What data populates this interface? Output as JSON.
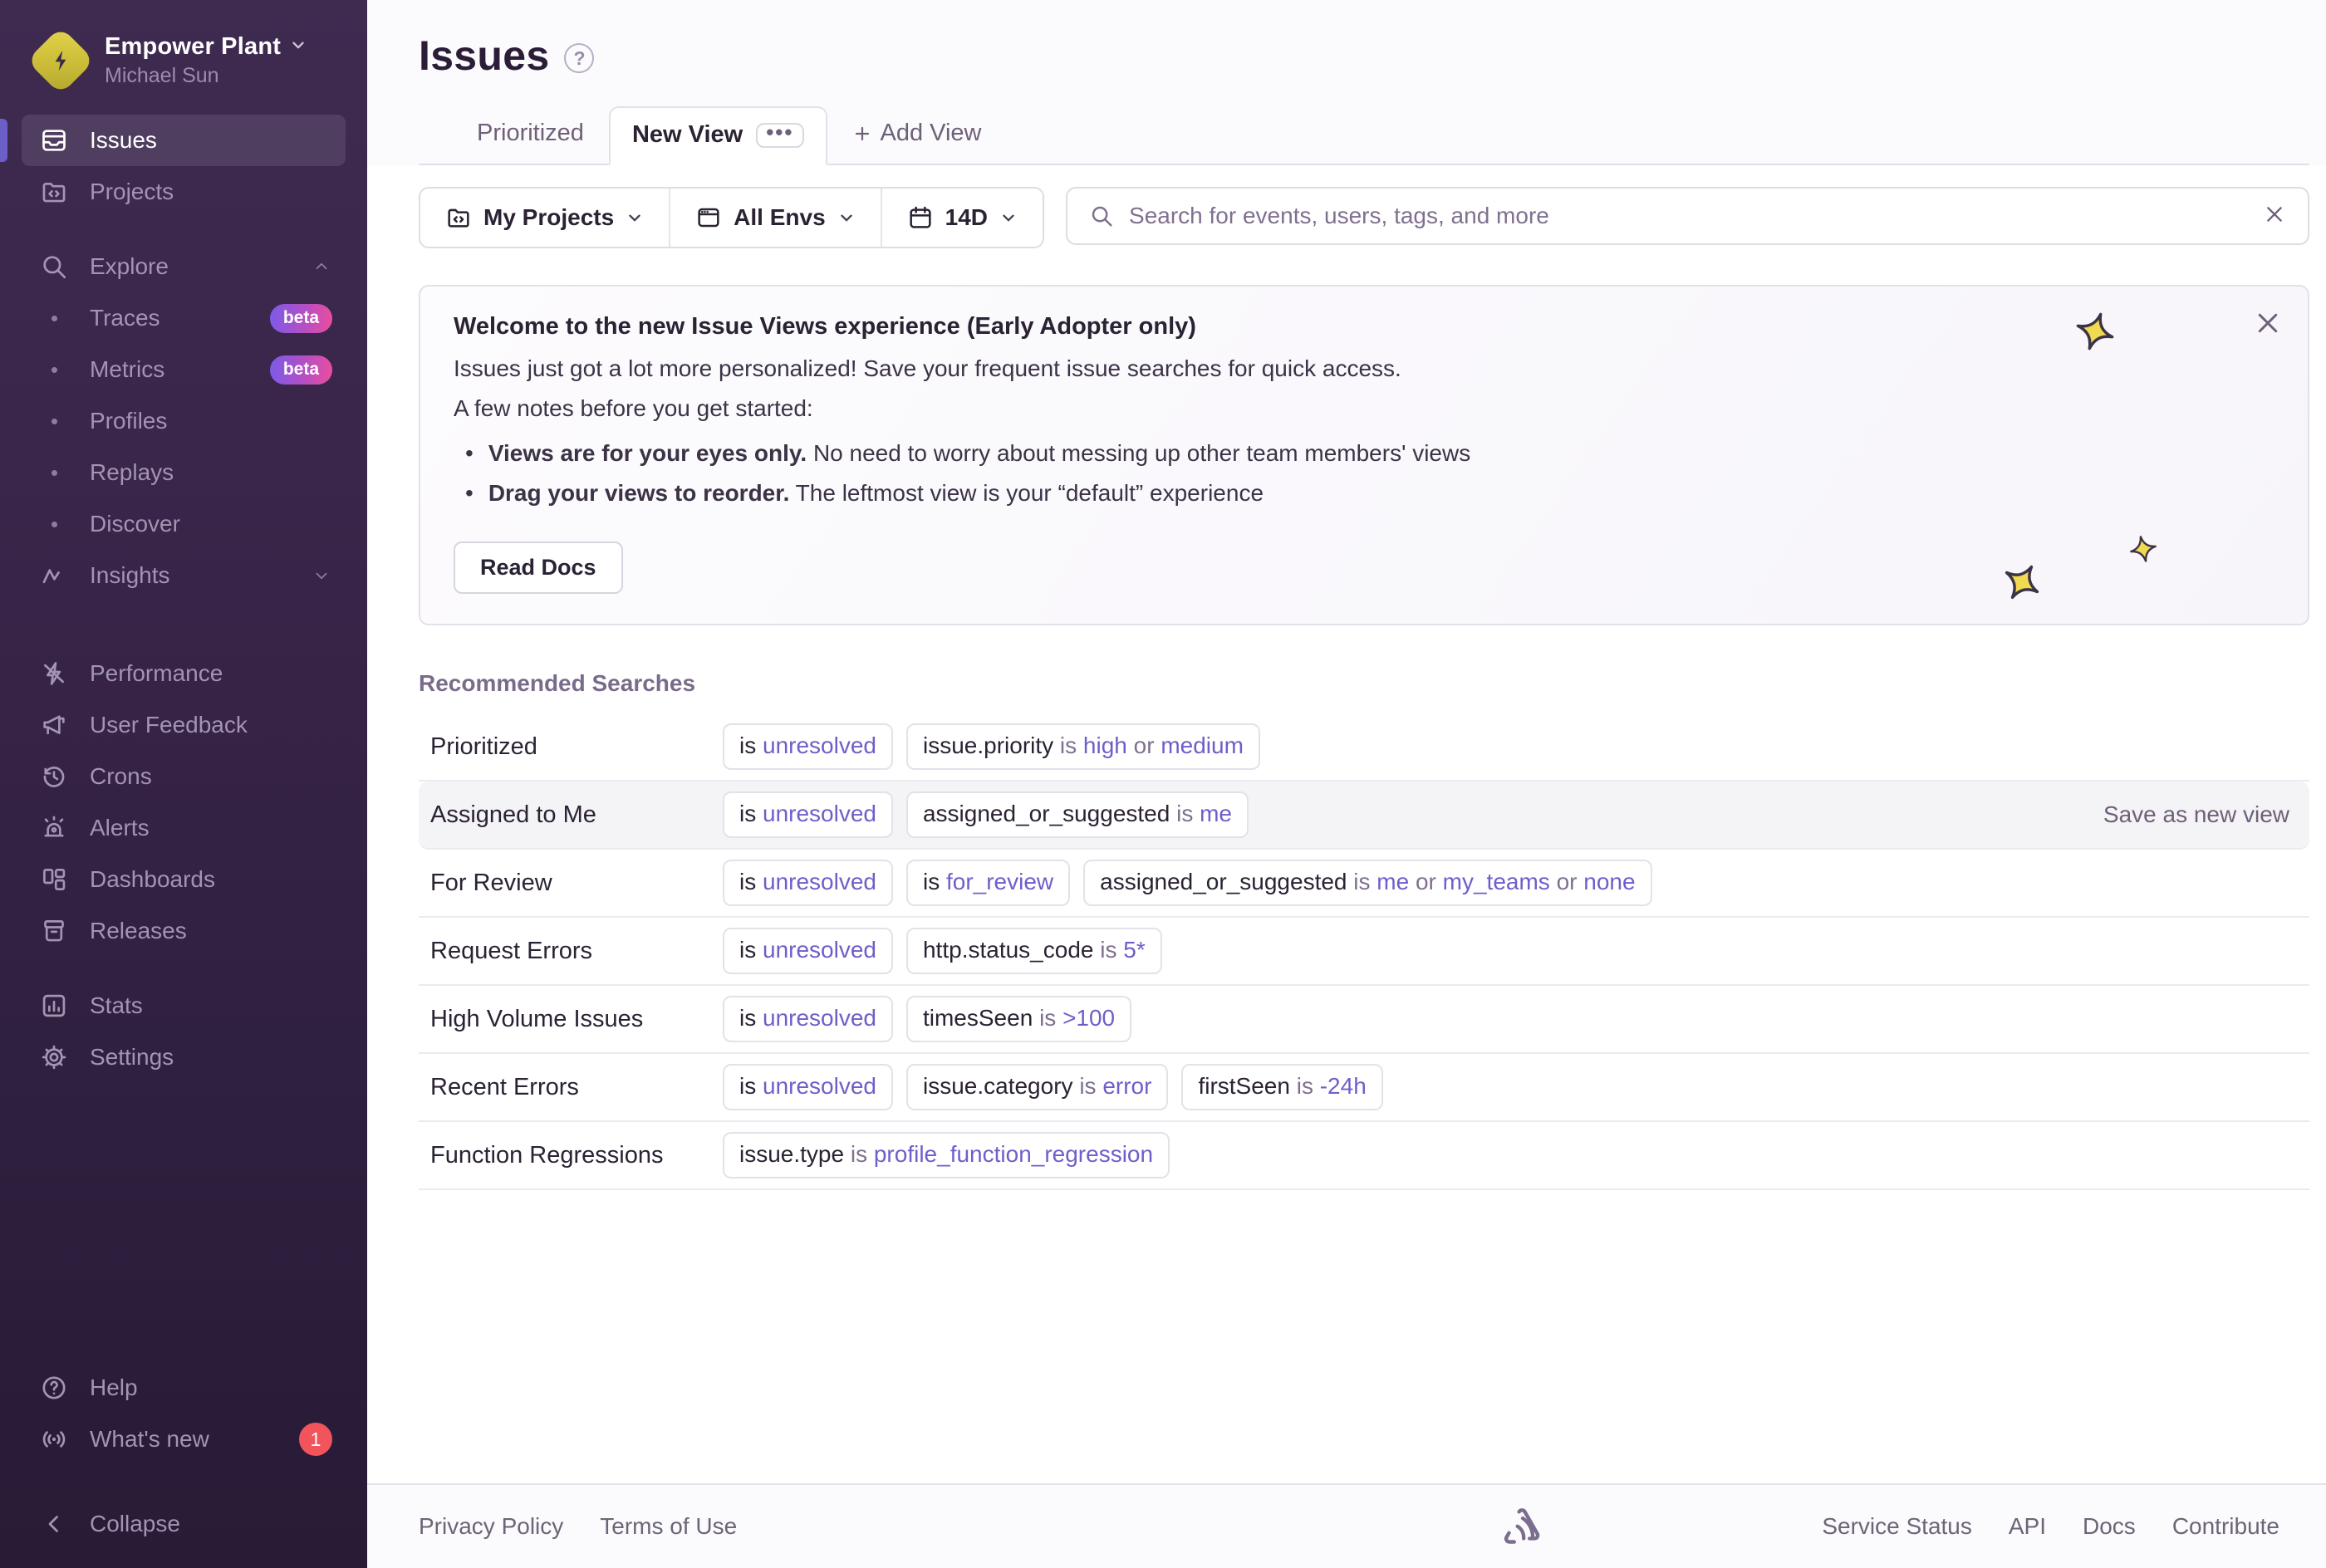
{
  "colors": {
    "accent": "#6c5fc7",
    "link": "#6d5fc9",
    "badge_red": "#f2545b",
    "beta_gradient_from": "#7a5be8",
    "beta_gradient_to": "#ec4e9d",
    "logo_yellow": "#d9c93f"
  },
  "sidebar": {
    "org": {
      "name": "Empower Plant",
      "user": "Michael Sun"
    },
    "primary": [
      {
        "label": "Issues",
        "icon": "issues",
        "active": true
      },
      {
        "label": "Projects",
        "icon": "projects",
        "active": false
      }
    ],
    "explore": {
      "label": "Explore",
      "icon": "search",
      "items": [
        {
          "label": "Traces",
          "beta": "beta"
        },
        {
          "label": "Metrics",
          "beta": "beta"
        },
        {
          "label": "Profiles"
        },
        {
          "label": "Replays"
        },
        {
          "label": "Discover"
        }
      ]
    },
    "insights": {
      "label": "Insights",
      "icon": "insights"
    },
    "tools": [
      {
        "label": "Performance",
        "icon": "performance"
      },
      {
        "label": "User Feedback",
        "icon": "feedback"
      },
      {
        "label": "Crons",
        "icon": "crons"
      },
      {
        "label": "Alerts",
        "icon": "alerts"
      },
      {
        "label": "Dashboards",
        "icon": "dashboards"
      },
      {
        "label": "Releases",
        "icon": "releases"
      }
    ],
    "meta": [
      {
        "label": "Stats",
        "icon": "stats"
      },
      {
        "label": "Settings",
        "icon": "settings"
      }
    ],
    "bottom": [
      {
        "label": "Help",
        "icon": "help"
      },
      {
        "label": "What's new",
        "icon": "broadcast",
        "badge": "1"
      }
    ],
    "collapse": "Collapse"
  },
  "header": {
    "title": "Issues",
    "tab_prioritized": "Prioritized",
    "tab_active": "New View",
    "add_view": "Add View"
  },
  "filters": {
    "projects": "My Projects",
    "envs": "All Envs",
    "period": "14D"
  },
  "search": {
    "placeholder": "Search for events, users, tags, and more"
  },
  "banner": {
    "title": "Welcome to the new Issue Views experience (Early Adopter only)",
    "line1": "Issues just got a lot more personalized! Save your frequent issue searches for quick access.",
    "line2": "A few notes before you get started:",
    "bullets": [
      {
        "bold": "Views are for your eyes only.",
        "rest": " No need to worry about messing up other team members' views"
      },
      {
        "bold": "Drag your views to reorder.",
        "rest": " The leftmost view is your “default” experience"
      }
    ],
    "button": "Read Docs"
  },
  "recommended": {
    "heading": "Recommended Searches",
    "rows": [
      {
        "label": "Prioritized",
        "highlight": false,
        "pills": [
          [
            {
              "t": "is ",
              "k": "d"
            },
            {
              "t": "unresolved",
              "k": "l"
            }
          ],
          [
            {
              "t": "issue.priority ",
              "k": "d"
            },
            {
              "t": "is ",
              "k": "m"
            },
            {
              "t": "high",
              "k": "l"
            },
            {
              "t": " or ",
              "k": "m"
            },
            {
              "t": "medium",
              "k": "l"
            }
          ]
        ]
      },
      {
        "label": "Assigned to Me",
        "highlight": true,
        "action": "Save as new view",
        "pills": [
          [
            {
              "t": "is ",
              "k": "d"
            },
            {
              "t": "unresolved",
              "k": "l"
            }
          ],
          [
            {
              "t": "assigned_or_suggested ",
              "k": "d"
            },
            {
              "t": "is ",
              "k": "m"
            },
            {
              "t": "me",
              "k": "l"
            }
          ]
        ]
      },
      {
        "label": "For Review",
        "highlight": false,
        "pills": [
          [
            {
              "t": "is ",
              "k": "d"
            },
            {
              "t": "unresolved",
              "k": "l"
            }
          ],
          [
            {
              "t": "is ",
              "k": "d"
            },
            {
              "t": "for_review",
              "k": "l"
            }
          ],
          [
            {
              "t": "assigned_or_suggested ",
              "k": "d"
            },
            {
              "t": "is ",
              "k": "m"
            },
            {
              "t": "me",
              "k": "l"
            },
            {
              "t": " or ",
              "k": "m"
            },
            {
              "t": "my_teams",
              "k": "l"
            },
            {
              "t": " or ",
              "k": "m"
            },
            {
              "t": "none",
              "k": "l"
            }
          ]
        ]
      },
      {
        "label": "Request Errors",
        "highlight": false,
        "pills": [
          [
            {
              "t": "is ",
              "k": "d"
            },
            {
              "t": "unresolved",
              "k": "l"
            }
          ],
          [
            {
              "t": "http.status_code ",
              "k": "d"
            },
            {
              "t": "is ",
              "k": "m"
            },
            {
              "t": "5*",
              "k": "l"
            }
          ]
        ]
      },
      {
        "label": "High Volume Issues",
        "highlight": false,
        "pills": [
          [
            {
              "t": "is ",
              "k": "d"
            },
            {
              "t": "unresolved",
              "k": "l"
            }
          ],
          [
            {
              "t": "timesSeen ",
              "k": "d"
            },
            {
              "t": "is ",
              "k": "m"
            },
            {
              "t": ">100",
              "k": "l"
            }
          ]
        ]
      },
      {
        "label": "Recent Errors",
        "highlight": false,
        "pills": [
          [
            {
              "t": "is ",
              "k": "d"
            },
            {
              "t": "unresolved",
              "k": "l"
            }
          ],
          [
            {
              "t": "issue.category ",
              "k": "d"
            },
            {
              "t": "is ",
              "k": "m"
            },
            {
              "t": "error",
              "k": "l"
            }
          ],
          [
            {
              "t": "firstSeen ",
              "k": "d"
            },
            {
              "t": "is ",
              "k": "m"
            },
            {
              "t": "-24h",
              "k": "l"
            }
          ]
        ]
      },
      {
        "label": "Function Regressions",
        "highlight": false,
        "pills": [
          [
            {
              "t": "issue.type ",
              "k": "d"
            },
            {
              "t": "is ",
              "k": "m"
            },
            {
              "t": "profile_function_regression",
              "k": "l"
            }
          ]
        ]
      }
    ]
  },
  "footer": {
    "left": [
      "Privacy Policy",
      "Terms of Use"
    ],
    "right": [
      "Service Status",
      "API",
      "Docs",
      "Contribute"
    ]
  }
}
